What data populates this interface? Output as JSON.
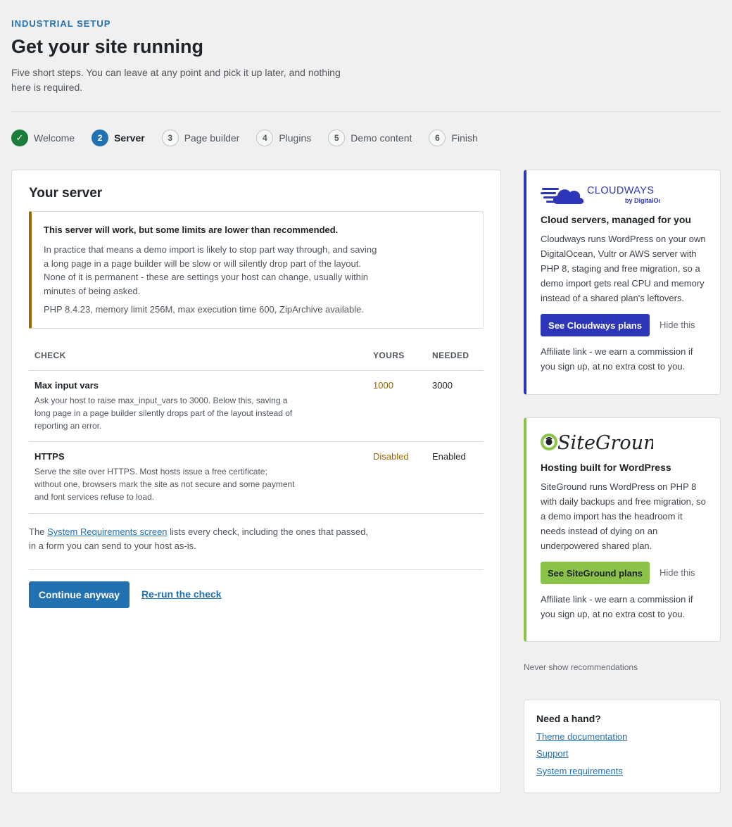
{
  "header": {
    "eyebrow": "INDUSTRIAL SETUP",
    "title": "Get your site running",
    "intro": "Five short steps. You can leave at any point and pick it up later, and nothing here is required."
  },
  "steps": [
    {
      "num": "✓",
      "label": "Welcome",
      "state": "done"
    },
    {
      "num": "2",
      "label": "Server",
      "state": "current"
    },
    {
      "num": "3",
      "label": "Page builder",
      "state": "upcoming"
    },
    {
      "num": "4",
      "label": "Plugins",
      "state": "upcoming"
    },
    {
      "num": "5",
      "label": "Demo content",
      "state": "upcoming"
    },
    {
      "num": "6",
      "label": "Finish",
      "state": "upcoming"
    }
  ],
  "server": {
    "title": "Your server",
    "notice": {
      "title": "This server will work, but some limits are lower than recommended.",
      "body": "In practice that means a demo import is likely to stop part way through, and saving a long page in a page builder will be slow or will silently drop part of the layout. None of it is permanent - these are settings your host can change, usually within minutes of being asked.",
      "facts": "PHP 8.4.23, memory limit 256M, max execution time 600, ZipArchive available."
    },
    "table": {
      "headers": {
        "check": "CHECK",
        "yours": "YOURS",
        "needed": "NEEDED"
      },
      "rows": [
        {
          "name": "Max input vars",
          "desc": "Ask your host to raise max_input_vars to 3000. Below this, saving a long page in a page builder silently drops part of the layout instead of reporting an error.",
          "yours": "1000",
          "needed": "3000"
        },
        {
          "name": "HTTPS",
          "desc": "Serve the site over HTTPS. Most hosts issue a free certificate; without one, browsers mark the site as not secure and some payment and font services refuse to load.",
          "yours": "Disabled",
          "needed": "Enabled"
        }
      ]
    },
    "footnote": {
      "before": "The ",
      "link": "System Requirements screen",
      "after": " lists every check, including the ones that passed, in a form you can send to your host as-is."
    },
    "continue_label": "Continue anyway",
    "rerun_label": "Re-run the check"
  },
  "sidebar": {
    "cloudways": {
      "logo_text": "CLOUDWAYS",
      "logo_sub": "by DigitalOcean",
      "heading": "Cloud servers, managed for you",
      "body": "Cloudways runs WordPress on your own DigitalOcean, Vultr or AWS server with PHP 8, staging and free migration, so a demo import gets real CPU and memory instead of a shared plan's leftovers.",
      "button": "See Cloudways plans",
      "hide": "Hide this",
      "affiliate": "Affiliate link - we earn a commission if you sign up, at no extra cost to you.",
      "color": "#2d35b8"
    },
    "siteground": {
      "logo_text": "SiteGround",
      "heading": "Hosting built for WordPress",
      "body": "SiteGround runs WordPress on PHP 8 with daily backups and free migration, so a demo import has the headroom it needs instead of dying on an underpowered shared plan.",
      "button": "See SiteGround plans",
      "hide": "Hide this",
      "affiliate": "Affiliate link - we earn a commission if you sign up, at no extra cost to you.",
      "color": "#8bc34a"
    },
    "never_show": "Never show recommendations",
    "help": {
      "title": "Need a hand?",
      "links": [
        "Theme documentation",
        "Support",
        "System requirements"
      ]
    }
  },
  "colors": {
    "accent": "#2271b1",
    "success": "#1d7c3a",
    "warning": "#9a6700",
    "background": "#f0f0f1"
  }
}
